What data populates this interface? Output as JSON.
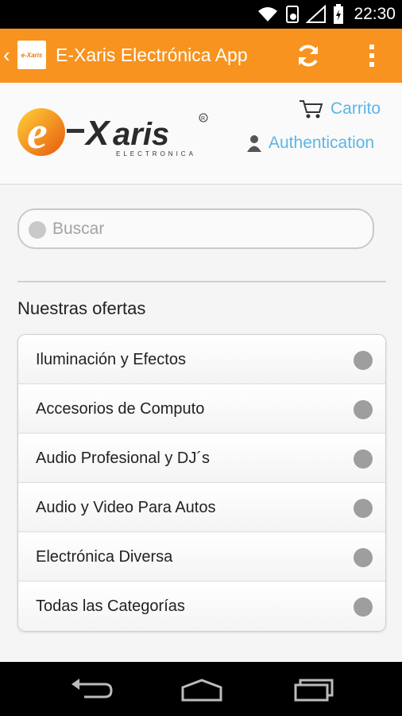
{
  "status_bar": {
    "time": "22:30"
  },
  "action_bar": {
    "title": "E-Xaris Electrónica App",
    "logo_text": "e-Xaris"
  },
  "header": {
    "brand": "e-Xaris",
    "brand_sub": "ELECTRONICA",
    "cart_label": "Carrito",
    "auth_label": "Authentication"
  },
  "search": {
    "placeholder": "Buscar",
    "value": ""
  },
  "offers": {
    "title": "Nuestras ofertas",
    "items": [
      {
        "label": "Iluminación y Efectos"
      },
      {
        "label": "Accesorios de Computo"
      },
      {
        "label": "Audio Profesional y DJ´s"
      },
      {
        "label": "Audio y Video Para Autos"
      },
      {
        "label": "Electrónica Diversa"
      },
      {
        "label": "Todas las Categorías"
      }
    ]
  },
  "colors": {
    "action_bar": "#f7931e",
    "link": "#5bb6e6",
    "dot": "#9e9e9e"
  }
}
